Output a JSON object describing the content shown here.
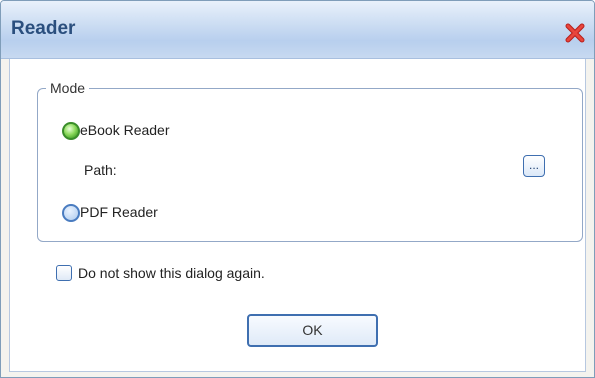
{
  "window": {
    "title": "Reader"
  },
  "mode_group": {
    "legend": "Mode",
    "options": [
      {
        "label": "eBook Reader",
        "checked": true
      },
      {
        "label": "PDF Reader",
        "checked": false
      }
    ],
    "path_label": "Path:",
    "browse_label": "..."
  },
  "footer": {
    "checkbox_label": "Do not show this dialog again.",
    "checkbox_checked": false,
    "ok_label": "OK"
  },
  "colors": {
    "title_text": "#2b4f7e",
    "close_icon": "#d0312d",
    "radio_checked": "#4aa82c",
    "border_accent": "#3f6fb0"
  }
}
